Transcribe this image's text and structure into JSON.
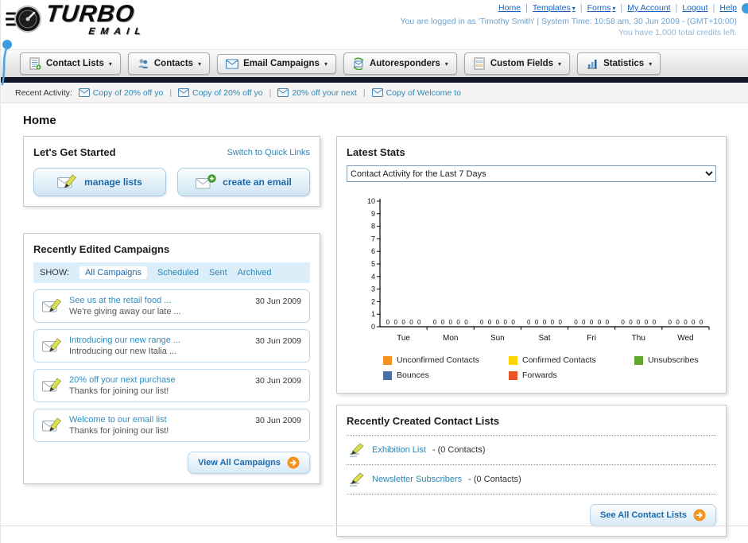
{
  "icons": {
    "chevron_down": "▾"
  },
  "header": {
    "logo_main": "TURBO",
    "logo_sub": "EMAIL",
    "top_links": [
      {
        "label": "Home",
        "dropdown": false
      },
      {
        "label": "Templates",
        "dropdown": true
      },
      {
        "label": "Forms",
        "dropdown": true
      },
      {
        "label": "My Account",
        "dropdown": false
      },
      {
        "label": "Logout",
        "dropdown": false
      },
      {
        "label": "Help",
        "dropdown": false
      }
    ],
    "login_text": "You are logged in as 'Timothy Smith' | System Time: 10:58 am, 30 Jun 2009 - (GMT+10:00)",
    "credits_text": "You have 1,000 total credits left."
  },
  "nav": {
    "tabs": [
      {
        "label": "Contact Lists"
      },
      {
        "label": "Contacts"
      },
      {
        "label": "Email Campaigns"
      },
      {
        "label": "Autoresponders"
      },
      {
        "label": "Custom Fields"
      },
      {
        "label": "Statistics"
      }
    ]
  },
  "recent_activity": {
    "label": "Recent Activity:",
    "items": [
      {
        "label": "Copy of 20% off yo"
      },
      {
        "label": "Copy of 20% off yo"
      },
      {
        "label": "20% off your next"
      },
      {
        "label": "Copy of Welcome to"
      }
    ]
  },
  "page_title": "Home",
  "get_started": {
    "title": "Let's Get Started",
    "switch_link": "Switch to Quick Links",
    "manage_lists_label": "manage lists",
    "create_email_label": "create an email"
  },
  "campaigns": {
    "title": "Recently Edited Campaigns",
    "show_label": "SHOW:",
    "filters": [
      {
        "label": "All Campaigns"
      },
      {
        "label": "Scheduled"
      },
      {
        "label": "Sent"
      },
      {
        "label": "Archived"
      }
    ],
    "items": [
      {
        "title": "See us at the retail food ...",
        "subtitle": "We're giving away our late ...",
        "date": "30 Jun 2009"
      },
      {
        "title": "Introducing our new range ...",
        "subtitle": "Introducing our new Italia ...",
        "date": "30 Jun 2009"
      },
      {
        "title": "20% off your next purchase",
        "subtitle": "Thanks for joining our list!",
        "date": "30 Jun 2009"
      },
      {
        "title": "Welcome to our email list",
        "subtitle": "Thanks for joining our list!",
        "date": "30 Jun 2009"
      }
    ],
    "view_all_label": "View All Campaigns"
  },
  "stats": {
    "title": "Latest Stats",
    "dropdown_value": "Contact Activity for the Last 7 Days",
    "chart_data": {
      "type": "bar",
      "categories": [
        "Tue",
        "Mon",
        "Sun",
        "Sat",
        "Fri",
        "Thu",
        "Wed"
      ],
      "series": [
        {
          "name": "Unconfirmed Contacts",
          "color": "#F5921E",
          "values": [
            0,
            0,
            0,
            0,
            0,
            0,
            0
          ]
        },
        {
          "name": "Confirmed Contacts",
          "color": "#FFD200",
          "values": [
            0,
            0,
            0,
            0,
            0,
            0,
            0
          ]
        },
        {
          "name": "Unsubscribes",
          "color": "#5FA82E",
          "values": [
            0,
            0,
            0,
            0,
            0,
            0,
            0
          ]
        },
        {
          "name": "Bounces",
          "color": "#4A6FA5",
          "values": [
            0,
            0,
            0,
            0,
            0,
            0,
            0
          ]
        },
        {
          "name": "Forwards",
          "color": "#E85426",
          "values": [
            0,
            0,
            0,
            0,
            0,
            0,
            0
          ]
        }
      ],
      "ylim": [
        0,
        10
      ],
      "yticks": [
        0,
        1,
        2,
        3,
        4,
        5,
        6,
        7,
        8,
        9,
        10
      ],
      "grid": false,
      "legend_position": "bottom"
    }
  },
  "contact_lists": {
    "title": "Recently Created Contact Lists",
    "items": [
      {
        "name": "Exhibition List",
        "suffix": "- (0 Contacts)"
      },
      {
        "name": "Newsletter Subscribers",
        "suffix": "- (0 Contacts)"
      }
    ],
    "see_all_label": "See All Contact Lists"
  }
}
